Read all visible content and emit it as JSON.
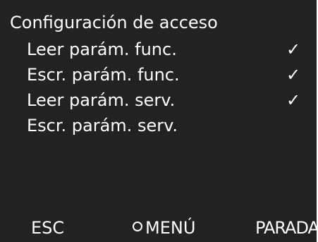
{
  "title": "Configuración de acceso",
  "items": [
    {
      "label": "Leer parám. func.",
      "check": "✓"
    },
    {
      "label": "Escr. parám. func.",
      "check": "✓"
    },
    {
      "label": "Leer parám. serv.",
      "check": "✓"
    },
    {
      "label": "Escr. parám. serv.",
      "check": ""
    }
  ],
  "softkeys": {
    "left": "ESC",
    "middle": "MENÚ",
    "right": "PARADA"
  },
  "colors": {
    "background": "#222222",
    "text": "#ffffff"
  }
}
